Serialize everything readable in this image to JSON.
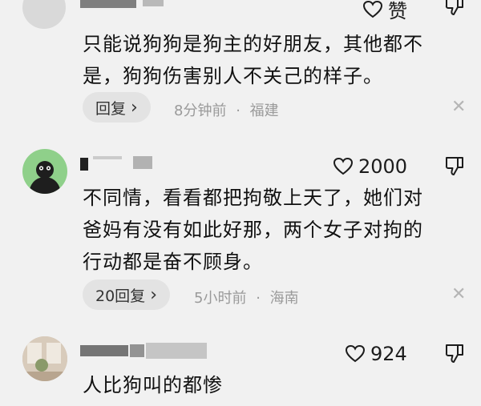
{
  "comments": [
    {
      "user": "",
      "likes": "赞",
      "text_lines": [
        "只能说狗狗是狗主的好朋友，其他都不",
        "是，狗狗伤害别人不关己的样子。"
      ],
      "reply_label": "回复",
      "time": "8分钟前",
      "location": "福建",
      "close": "✕"
    },
    {
      "user": "",
      "likes": "2000",
      "text_lines": [
        "不同情，看看都把拘敬上天了，她们对",
        "爸妈有没有如此好那，两个女子对拘的",
        "行动都是奋不顾身。"
      ],
      "reply_label": "20回复",
      "time": "5小时前",
      "location": "海南",
      "close": "✕"
    },
    {
      "user": "",
      "likes": "924",
      "text_lines": [
        "人比狗叫的都惨"
      ]
    }
  ],
  "meta_separator": "·",
  "reply_chevron": "›"
}
